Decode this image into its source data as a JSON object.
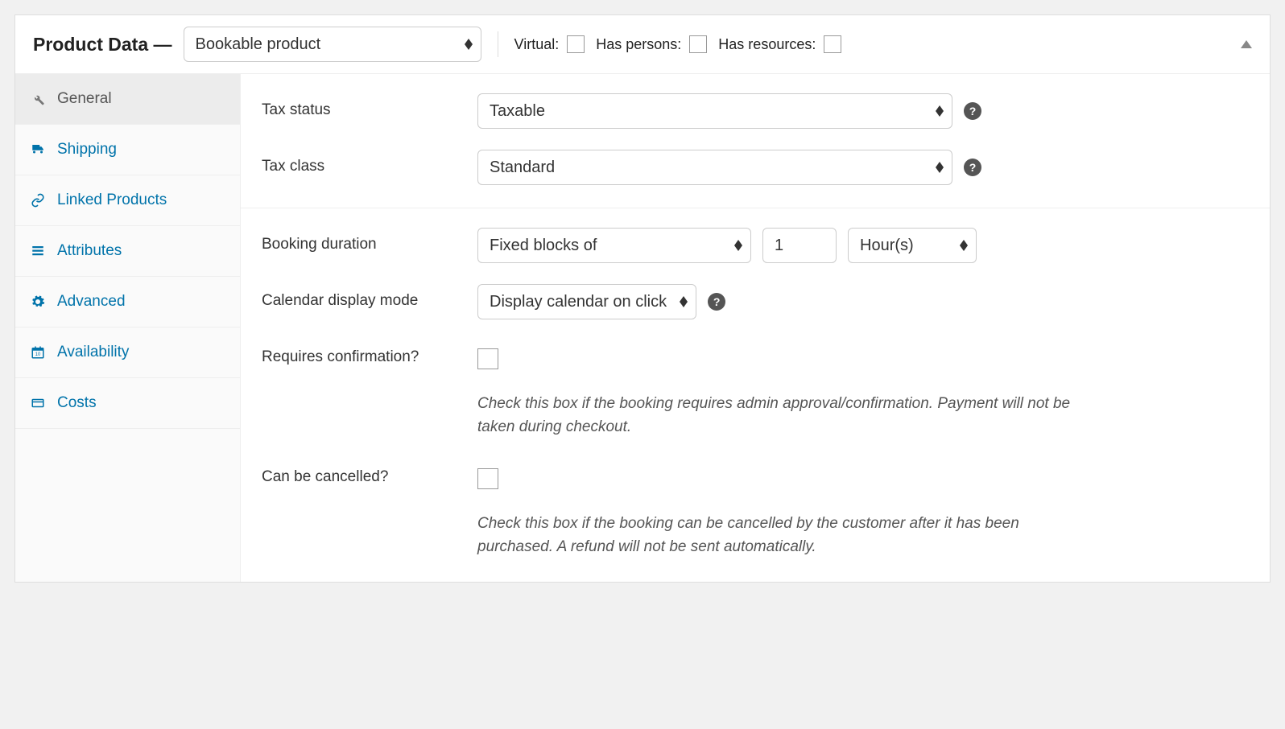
{
  "header": {
    "title": "Product Data —",
    "product_type": "Bookable product",
    "virtual_label": "Virtual:",
    "has_persons_label": "Has persons:",
    "has_resources_label": "Has resources:"
  },
  "sidebar": {
    "tabs": [
      {
        "id": "general",
        "label": "General",
        "icon": "wrench-icon",
        "active": true
      },
      {
        "id": "shipping",
        "label": "Shipping",
        "icon": "truck-icon",
        "active": false
      },
      {
        "id": "linked",
        "label": "Linked Products",
        "icon": "link-icon",
        "active": false
      },
      {
        "id": "attributes",
        "label": "Attributes",
        "icon": "list-icon",
        "active": false
      },
      {
        "id": "advanced",
        "label": "Advanced",
        "icon": "gear-icon",
        "active": false
      },
      {
        "id": "availability",
        "label": "Availability",
        "icon": "calendar-icon",
        "active": false
      },
      {
        "id": "costs",
        "label": "Costs",
        "icon": "card-icon",
        "active": false
      }
    ]
  },
  "fields": {
    "tax_status": {
      "label": "Tax status",
      "value": "Taxable"
    },
    "tax_class": {
      "label": "Tax class",
      "value": "Standard"
    },
    "booking_duration": {
      "label": "Booking duration",
      "type": "Fixed blocks of",
      "amount": "1",
      "unit": "Hour(s)"
    },
    "calendar_display": {
      "label": "Calendar display mode",
      "value": "Display calendar on click"
    },
    "requires_confirmation": {
      "label": "Requires confirmation?",
      "description": "Check this box if the booking requires admin approval/confirmation. Payment will not be taken during checkout."
    },
    "can_be_cancelled": {
      "label": "Can be cancelled?",
      "description": "Check this box if the booking can be cancelled by the customer after it has been purchased. A refund will not be sent automatically."
    }
  }
}
